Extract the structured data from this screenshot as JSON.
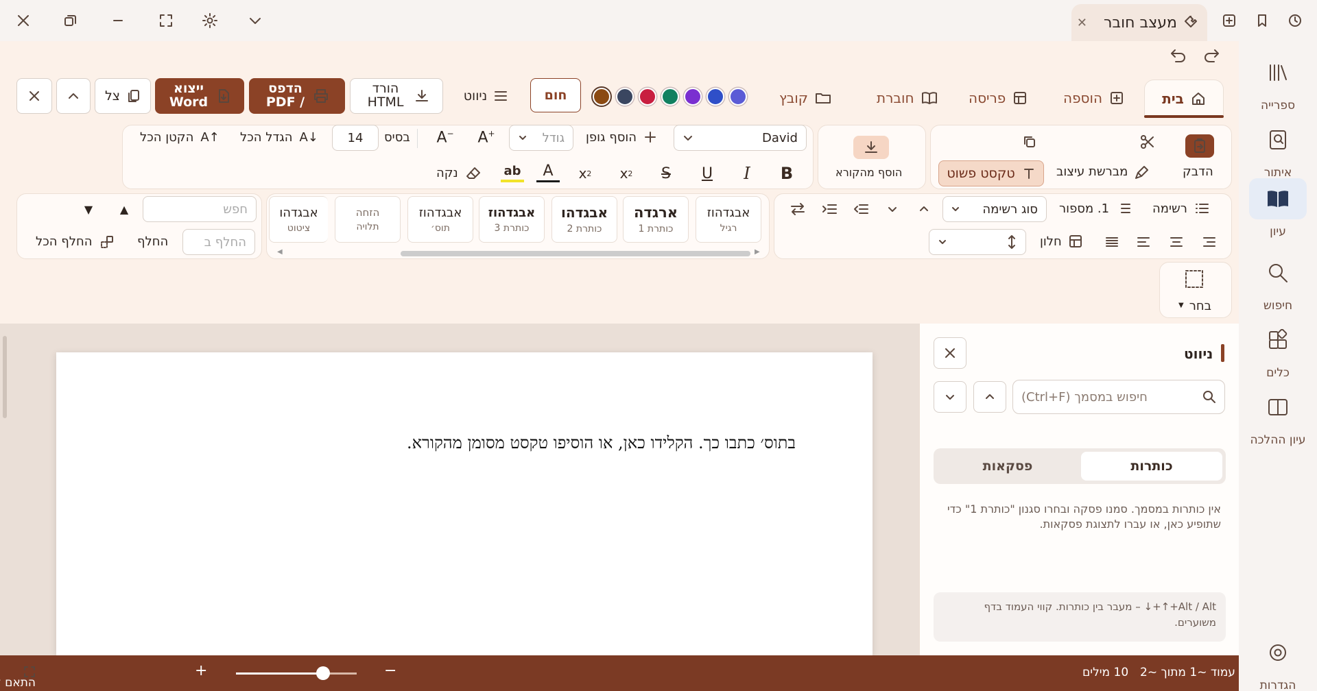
{
  "window": {
    "tab_title": "מעצב חובר"
  },
  "sidebar": {
    "items": [
      {
        "label": "ספרייה",
        "icon": "library-icon"
      },
      {
        "label": "איתור",
        "icon": "locate-icon"
      },
      {
        "label": "עיון",
        "icon": "book-icon"
      },
      {
        "label": "חיפוש",
        "icon": "search-icon"
      },
      {
        "label": "כלים",
        "icon": "tools-icon"
      },
      {
        "label": "עיון ההלכה",
        "icon": "split-book-icon"
      },
      {
        "label": "הגדרות",
        "icon": "gear-icon"
      }
    ]
  },
  "ribbon": {
    "tabs": [
      {
        "label": "בית"
      },
      {
        "label": "הוספה"
      },
      {
        "label": "פריסה"
      },
      {
        "label": "חוברת"
      },
      {
        "label": "קובץ"
      }
    ],
    "theme_colors": [
      "#5b5bd6",
      "#2f4fc8",
      "#7a2fd0",
      "#118060",
      "#c81e40",
      "#3a4660",
      "#8b4a12"
    ],
    "warm_label": "חום",
    "nav_label": "ניווט",
    "download_html_label": "הורד HTML",
    "print_pdf_label": "הדפס / PDF",
    "export_word_label": "ייצוא Word",
    "shadow_label": "צל",
    "clipboard": {
      "paste_label": "הדבק",
      "format_painter_label": "מברשת עיצוב",
      "plain_text_label": "טקסט פשוט"
    },
    "add_from_reader_label": "הוסף מהקורא",
    "font": {
      "family": "David",
      "size_placeholder": "גודל",
      "add_font_label": "הוסף גופן",
      "base_label": "בסיס",
      "base_value": "14",
      "grow_all_label": "הגדל הכל",
      "shrink_all_label": "הקטן הכל",
      "clear_label": "נקה"
    },
    "paragraph": {
      "list_label": "רשימה",
      "numbered_label": "1. מספור",
      "list_type_label": "סוג רשימה",
      "window_label": "חלון"
    },
    "styles": [
      {
        "text": "אבגדהוז",
        "name": "רגיל"
      },
      {
        "text": "ארגדה",
        "name": "כותרת 1"
      },
      {
        "text": "אבגדהו",
        "name": "כותרת 2"
      },
      {
        "text": "אבגדהוז",
        "name": "כותרת 3"
      },
      {
        "text": "אבגדהוז",
        "name": "תוס׳"
      },
      {
        "text": "הזחה",
        "name": "תלויה"
      },
      {
        "text": "אבגדהו",
        "name": "ציטוט"
      }
    ],
    "find": {
      "search_placeholder": "חפש",
      "replace_placeholder": "החלף ב",
      "replace_label": "החלף",
      "replace_all_label": "החלף הכל"
    },
    "select_label": "בחר"
  },
  "document": {
    "text": "בתוס׳ כתבו כך. הקלידו כאן, או הוסיפו טקסט מסומן מהקורא."
  },
  "nav_panel": {
    "title": "ניווט",
    "search_placeholder": "חיפוש במסמך (Ctrl+F)",
    "tabs": [
      {
        "label": "כותרות"
      },
      {
        "label": "פסקאות"
      }
    ],
    "empty_message": "אין כותרות במסמך. סמנו פסקה ובחרו סגנון \"כותרת 1\" כדי שתופיע כאן, או עברו לתצוגת פסקאות.",
    "hint": "Alt / Alt+↑+↓ – מעבר בין כותרות. קווי העמוד בדף משוערים."
  },
  "status": {
    "page": "עמוד ~1 מתוך ~2",
    "words": "10 מילים",
    "zoom_level": 0.72,
    "fit_width_label": "התאם לרוחב"
  }
}
